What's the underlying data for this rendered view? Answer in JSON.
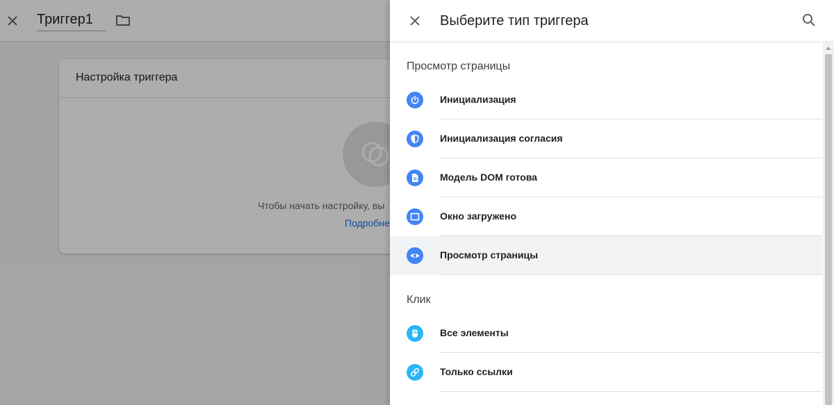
{
  "editor": {
    "trigger_name": "Триггер1",
    "card_title": "Настройка триггера",
    "hint_text": "Чтобы начать настройку, вы",
    "learn_more": "Подробне"
  },
  "drawer": {
    "title": "Выберите тип триггера",
    "sections": [
      {
        "heading": "Просмотр страницы",
        "items": [
          {
            "label": "Инициализация",
            "icon": "power-icon",
            "color": "#4285f4"
          },
          {
            "label": "Инициализация согласия",
            "icon": "shield-icon",
            "color": "#4285f4"
          },
          {
            "label": "Модель DOM готова",
            "icon": "document-icon",
            "color": "#4285f4"
          },
          {
            "label": "Окно загружено",
            "icon": "window-icon",
            "color": "#4285f4"
          },
          {
            "label": "Просмотр страницы",
            "icon": "eye-icon",
            "color": "#4285f4",
            "selected": true
          }
        ]
      },
      {
        "heading": "Клик",
        "items": [
          {
            "label": "Все элементы",
            "icon": "mouse-icon",
            "color": "#29b6f6"
          },
          {
            "label": "Только ссылки",
            "icon": "link-icon",
            "color": "#29b6f6"
          }
        ]
      }
    ]
  },
  "colors": {
    "page_view_icon": "#4285f4",
    "click_icon": "#29b6f6",
    "link": "#1a73e8",
    "selected_row": "#f1f3f4"
  }
}
